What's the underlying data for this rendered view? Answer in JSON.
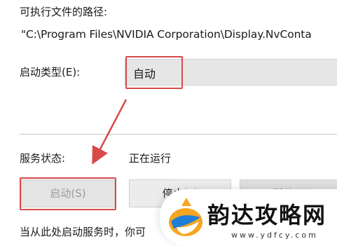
{
  "executable": {
    "label": "可执行文件的路径:",
    "path": "\"C:\\Program Files\\NVIDIA Corporation\\Display.NvConta"
  },
  "startup_type": {
    "label": "启动类型(E):",
    "value": "自动"
  },
  "service_status": {
    "label": "服务状态:",
    "value": "正在运行"
  },
  "buttons": {
    "start": "启动(S)",
    "stop": "停止(T)",
    "pause": "暂停(P)"
  },
  "hint_text": "当从此处启动服务时，你可",
  "watermark": {
    "text": "韵达攻略网",
    "url": "www.ydfcy.com"
  },
  "colors": {
    "highlight": "#d84a4a",
    "arrow": "#d84a4a"
  }
}
